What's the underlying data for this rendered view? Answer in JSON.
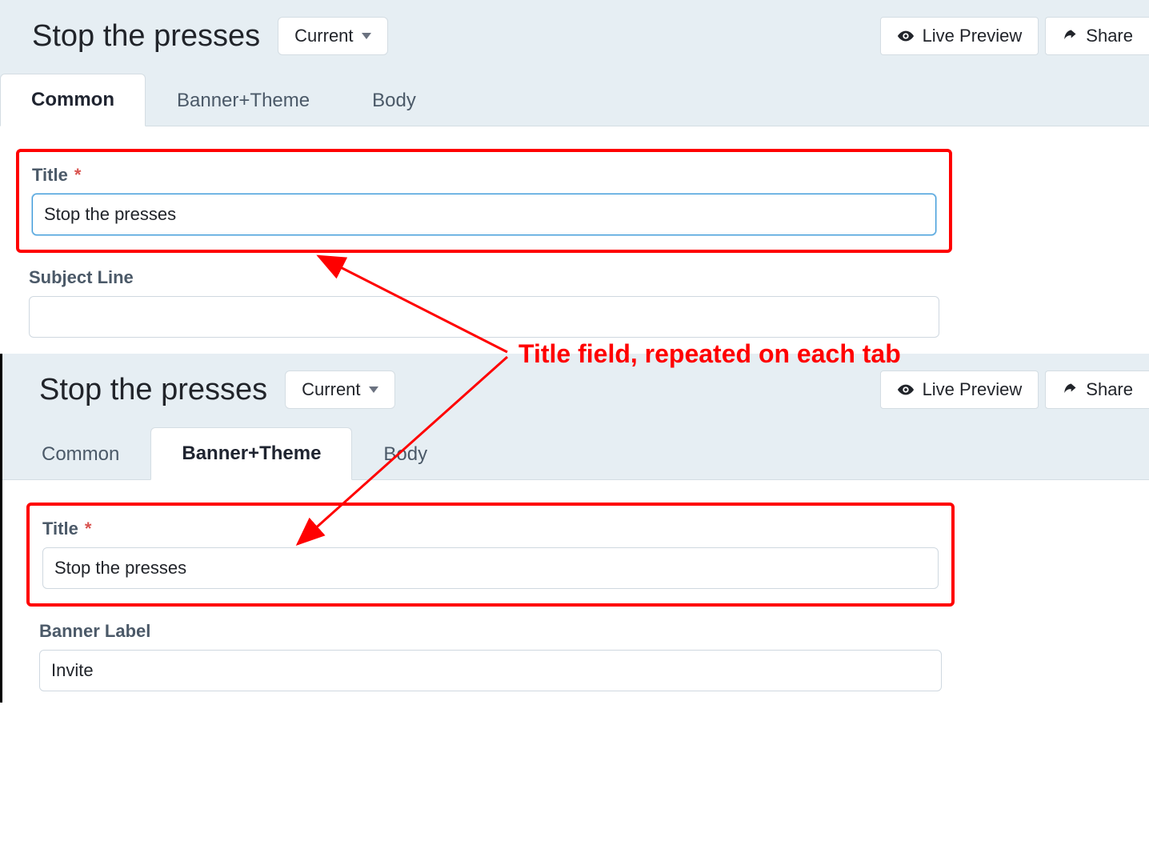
{
  "panel1": {
    "title": "Stop the presses",
    "version_label": "Current",
    "live_preview": "Live Preview",
    "share": "Share",
    "tabs": {
      "common": "Common",
      "banner": "Banner+Theme",
      "body": "Body"
    },
    "fields": {
      "title_label": "Title",
      "title_value": "Stop the presses",
      "subject_label": "Subject Line",
      "subject_value": ""
    }
  },
  "panel2": {
    "title": "Stop the presses",
    "version_label": "Current",
    "live_preview": "Live Preview",
    "share": "Share",
    "tabs": {
      "common": "Common",
      "banner": "Banner+Theme",
      "body": "Body"
    },
    "fields": {
      "title_label": "Title",
      "title_value": "Stop the presses",
      "banner_label": "Banner Label",
      "banner_value": "Invite"
    }
  },
  "annotation": {
    "text": "Title field, repeated on each tab"
  },
  "required_mark": "*"
}
